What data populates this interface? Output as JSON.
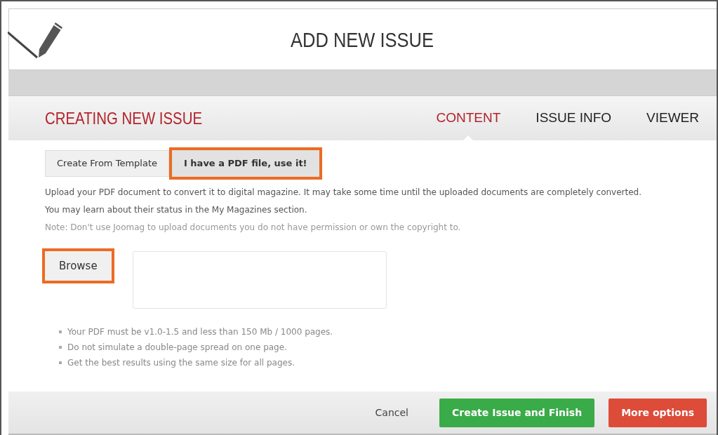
{
  "window": {
    "title": "ADD NEW ISSUE"
  },
  "panel": {
    "title": "CREATING NEW ISSUE"
  },
  "tabs": [
    {
      "label": "CONTENT",
      "selected": true
    },
    {
      "label": "ISSUE INFO",
      "selected": false
    },
    {
      "label": "VIEWER",
      "selected": false
    }
  ],
  "source_options": [
    {
      "label": "Create From Template",
      "selected": false,
      "highlighted": false
    },
    {
      "label": "I have a PDF file, use it!",
      "selected": true,
      "highlighted": true
    }
  ],
  "description": "Upload your PDF document to convert it to digital magazine. It may take some time until the uploaded documents are completely converted. You may learn about their status in the My Magazines section.",
  "note": "Note: Don't use Joomag to upload documents you do not have permission or own the copyright to.",
  "browse_button": {
    "label": "Browse",
    "highlighted": true
  },
  "requirements": [
    "Your PDF must be v1.0-1.5 and less than 150 Mb / 1000 pages.",
    "Do not simulate a double-page spread on one page.",
    "Get the best results using the same size for all pages."
  ],
  "footer": {
    "cancel": "Cancel",
    "primary": "Create Issue and Finish",
    "secondary": "More options"
  }
}
